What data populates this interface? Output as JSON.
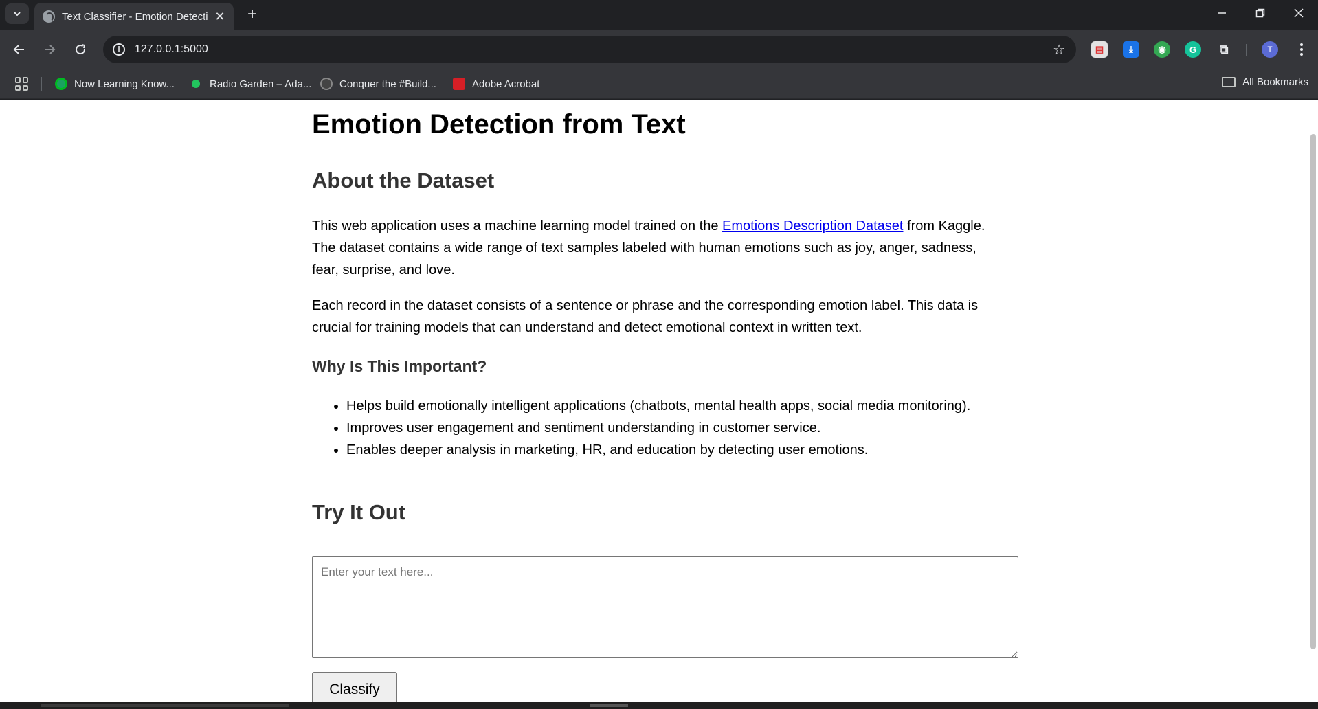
{
  "browser": {
    "tab_title": "Text Classifier - Emotion Detection",
    "new_tab_label": "+",
    "url": "127.0.0.1:5000",
    "profile_initial": "T",
    "bookmarks": [
      {
        "label": "Now Learning Know...",
        "icon": "now-learning-icon",
        "color": "#1aa260"
      },
      {
        "label": "Radio Garden – Ada...",
        "icon": "radio-garden-icon",
        "color": "#22c55e"
      },
      {
        "label": "Conquer the #Build...",
        "icon": "conquer-icon",
        "color": "#444444"
      },
      {
        "label": "Adobe Acrobat",
        "icon": "adobe-acrobat-icon",
        "color": "#d61f26"
      }
    ],
    "all_bookmarks_label": "All Bookmarks"
  },
  "page": {
    "title": "Emotion Detection from Text",
    "about_heading": "About the Dataset",
    "para1_before": "This web application uses a machine learning model trained on the ",
    "para1_link": "Emotions Description Dataset",
    "para1_after": " from Kaggle. The dataset contains a wide range of text samples labeled with human emotions such as joy, anger, sadness, fear, surprise, and love.",
    "para2": "Each record in the dataset consists of a sentence or phrase and the corresponding emotion label. This data is crucial for training models that can understand and detect emotional context in written text.",
    "why_heading": "Why Is This Important?",
    "bullets": [
      "Helps build emotionally intelligent applications (chatbots, mental health apps, social media monitoring).",
      "Improves user engagement and sentiment understanding in customer service.",
      "Enables deeper analysis in marketing, HR, and education by detecting user emotions."
    ],
    "try_heading": "Try It Out",
    "input_placeholder": "Enter your text here...",
    "classify_label": "Classify"
  }
}
